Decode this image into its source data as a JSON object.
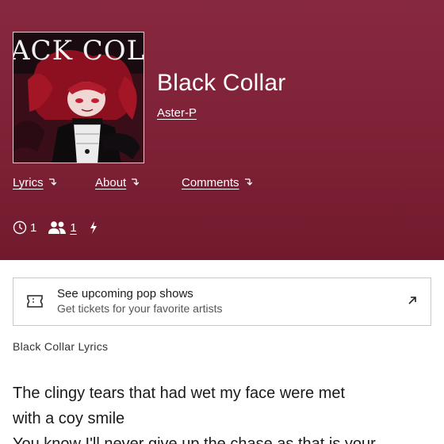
{
  "song": {
    "title": "Black Collar",
    "artist": "Aster-P",
    "cover_text": "ACK COLL"
  },
  "tabs": [
    {
      "label": "Lyrics",
      "icon": "arrow-down-right-icon"
    },
    {
      "label": "About",
      "icon": "arrow-down-right-icon"
    },
    {
      "label": "Comments",
      "icon": "arrow-down-right-icon"
    }
  ],
  "stats": {
    "contributors": "1",
    "pyongs": "1",
    "icons": [
      "clock-icon",
      "users-icon",
      "lightning-icon"
    ]
  },
  "promo": {
    "title": "See upcoming pop shows",
    "subtitle": "Get tickets for your favorite artists",
    "icon": "ticket-icon",
    "link_icon": "external-arrow-icon"
  },
  "lyrics_heading": "Black Collar Lyrics",
  "lyrics_lines": [
    "The clingy tears that had wet my face were met",
    "with a coy smile",
    "You know I'll never give up the chase as that is your"
  ],
  "colors": {
    "hero_bg": "#7e2136",
    "text_on_hero": "#ffffff"
  }
}
